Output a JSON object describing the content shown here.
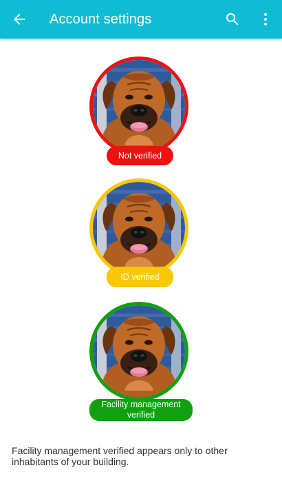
{
  "appbar": {
    "title": "Account settings",
    "icons": [
      "arrow-back-icon",
      "search-icon",
      "more-vert-icon"
    ],
    "color": "#0fbcd4"
  },
  "verification_levels": [
    {
      "label": "Not verified",
      "color": "#ee1111"
    },
    {
      "label": "ID verified",
      "color": "#f8c800"
    },
    {
      "label": "Facility management verified",
      "color": "#11a011"
    }
  ],
  "note": "Facility management verified appears only to other inhabitants of your building."
}
